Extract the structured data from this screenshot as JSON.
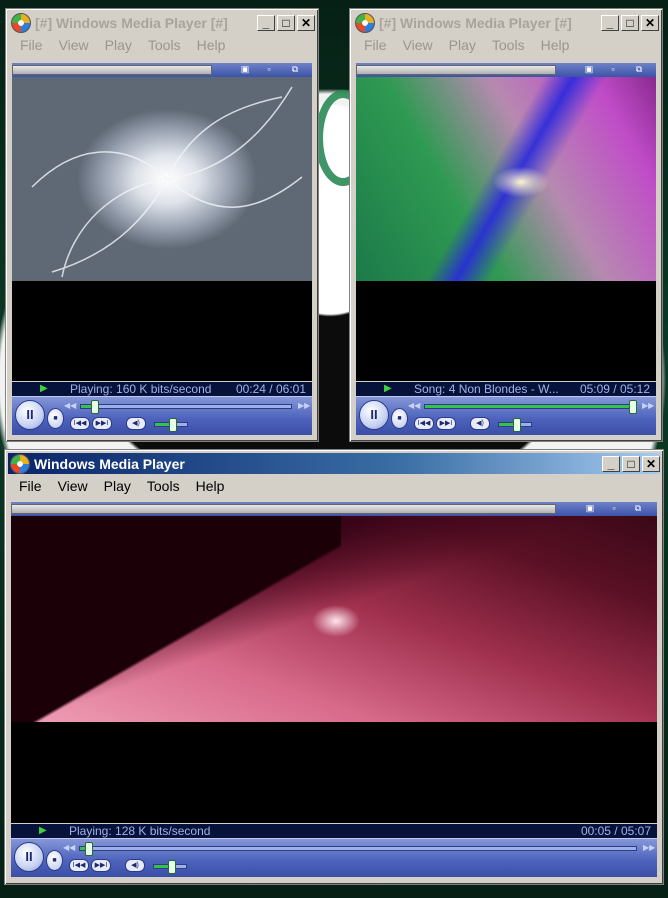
{
  "windows": [
    {
      "title": "[#] Windows Media Player [#]",
      "state": "inactive",
      "menu": [
        "File",
        "View",
        "Play",
        "Tools",
        "Help"
      ],
      "status_text": "Playing: 160 K bits/second",
      "status_time": "00:24 / 06:01",
      "seek_progress": 0.066,
      "volume_level": 0.55
    },
    {
      "title": "[#] Windows Media Player [#]",
      "state": "inactive",
      "menu": [
        "File",
        "View",
        "Play",
        "Tools",
        "Help"
      ],
      "status_text": "Song: 4 Non Blondes - W...",
      "status_time": "05:09 / 05:12",
      "seek_progress": 0.99,
      "volume_level": 0.55
    },
    {
      "title": "Windows Media Player",
      "state": "active",
      "menu": [
        "File",
        "View",
        "Play",
        "Tools",
        "Help"
      ],
      "status_text": "Playing: 128 K bits/second",
      "status_time": "00:05 / 05:07",
      "seek_progress": 0.016,
      "volume_level": 0.55
    }
  ],
  "titlebar_buttons": {
    "minimize": "_",
    "maximize": "□",
    "close": "✕"
  },
  "controls": {
    "pause": "II",
    "stop": "■",
    "previous": "I◀◀",
    "next": "▶▶I",
    "mute": "◀)",
    "rewind": "◀◀",
    "fast_forward": "▶▶"
  },
  "colors": {
    "active_title": "#0a246a",
    "controls_blue": "#4f64bd",
    "seek_green": "#35c24c"
  }
}
